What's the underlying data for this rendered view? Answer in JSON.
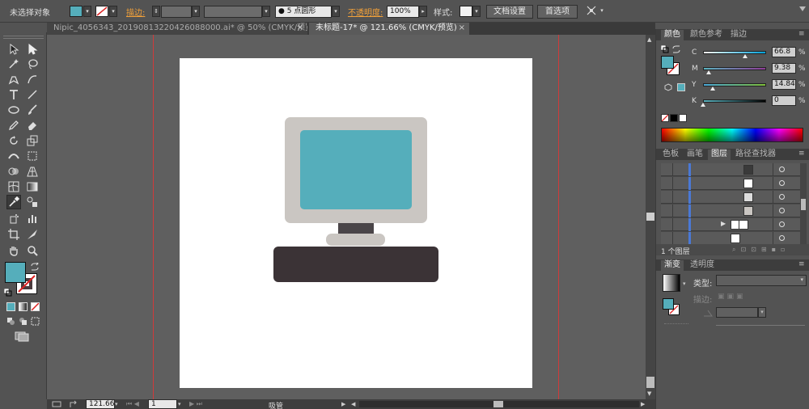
{
  "control_bar": {
    "selection_status": "未选择对象",
    "stroke_label": "描边:",
    "brush_label": "5 点圆形",
    "opacity_label": "不透明度:",
    "opacity_value": "100%",
    "style_label": "样式:",
    "doc_settings_button": "文档设置",
    "preferences_button": "首选项"
  },
  "tabs": [
    {
      "label": "Nipic_4056343_20190813220426088000.ai* @ 50% (CMYK/预览)",
      "close": "×"
    },
    {
      "label": "未标题-17* @ 121.66% (CMYK/预览)",
      "close": "×"
    }
  ],
  "color_panel": {
    "tabs": [
      "颜色",
      "颜色参考",
      "描边"
    ],
    "channels": [
      {
        "name": "C",
        "value": "66.8",
        "unit": "%",
        "level": 0.668
      },
      {
        "name": "M",
        "value": "9.38",
        "unit": "%",
        "level": 0.094
      },
      {
        "name": "Y",
        "value": "14.84",
        "unit": "%",
        "level": 0.148
      },
      {
        "name": "K",
        "value": "0",
        "unit": "%",
        "level": 0
      }
    ],
    "fill_color": "#55aebb"
  },
  "layers_panel": {
    "tabs": [
      "色板",
      "画笔",
      "图层",
      "路径查找器"
    ],
    "footer": "1 个图层"
  },
  "gradient_panel": {
    "tabs": [
      "渐变",
      "透明度"
    ],
    "type_label": "类型:",
    "stroke_label": "描边:"
  },
  "status_bar": {
    "zoom": "121.66",
    "page": "1",
    "tool_name": "吸管"
  },
  "artwork": {
    "monitor_frame_color": "#cac6c2",
    "screen_color": "#55aebb",
    "neck_color": "#4a4548",
    "base_color": "#cac6c2",
    "keyboard_color": "#3b3336"
  },
  "colors": {
    "accent_orange": "#f2a13a",
    "guide_red": "#d03a3a",
    "layer_blue": "#4a79d6"
  }
}
